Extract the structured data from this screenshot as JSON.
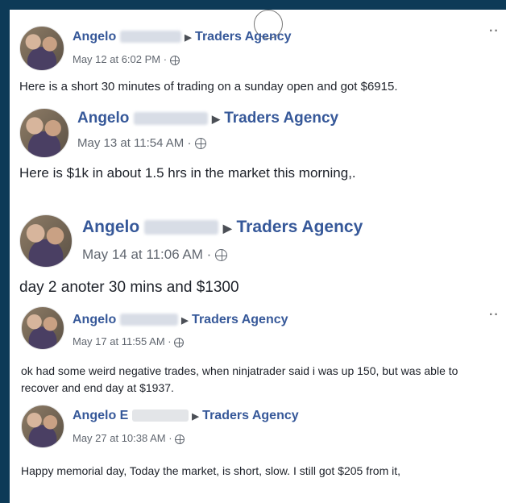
{
  "posts": [
    {
      "author": "Angelo",
      "page": "Traders Agency",
      "date": "May 12 at 6:02 PM",
      "sep": "·",
      "text": "Here is a short 30 minutes of trading on a sunday open and got $6915."
    },
    {
      "author": "Angelo",
      "page": "Traders Agency",
      "date": "May 13 at 11:54 AM",
      "sep": "·",
      "text": "Here is $1k in about 1.5 hrs in the market this morning,."
    },
    {
      "author": "Angelo",
      "page": "Traders Agency",
      "date": "May 14 at 11:06 AM",
      "sep": "·",
      "text": "day 2 anoter 30 mins and $1300"
    },
    {
      "author": "Angelo",
      "page": "Traders Agency",
      "date": "May 17 at 11:55 AM",
      "sep": "·",
      "text": "ok had some weird negative trades, when ninjatrader said i was up 150, but was able to recover and end day at $1937."
    },
    {
      "author": "Angelo E",
      "page": "Traders Agency",
      "date": "May 27 at 10:38 AM",
      "sep": "·",
      "text": "Happy memorial day, Today the market, is short, slow. I still got $205 from it,"
    }
  ],
  "icons": {
    "arrow": "▶",
    "more": "··"
  },
  "colors": {
    "background": "#0d3a57",
    "link": "#365899",
    "meta": "#616770",
    "text": "#1d2129"
  }
}
